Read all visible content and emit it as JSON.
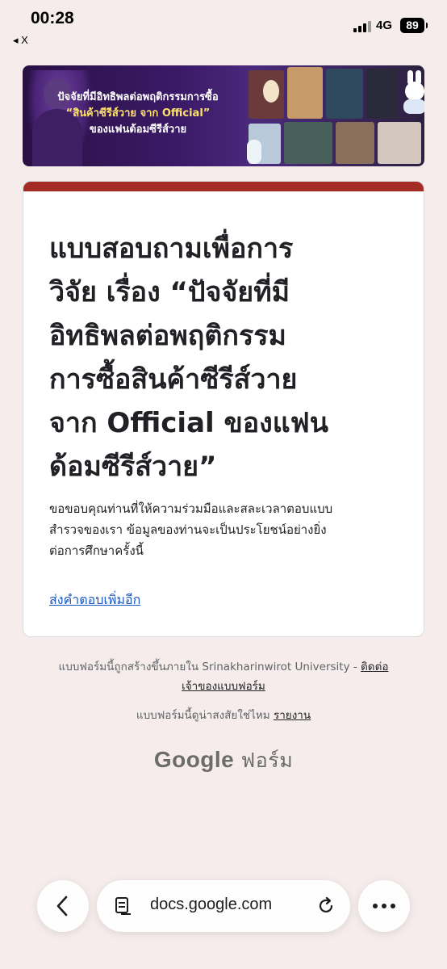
{
  "status_bar": {
    "time": "00:28",
    "back_app": "◂ X",
    "network": "4G",
    "battery": "89"
  },
  "banner": {
    "line1": "ปัจจัยที่มีอิทธิพลต่อพฤติกรรมการซื้อ",
    "line2": "“สินค้าซีรีส์วาย จาก Official”",
    "line3": "ของแฟนด้อมซีรีส์วาย"
  },
  "form": {
    "accent_color": "#a52b26",
    "title_lines": [
      "แบบสอบถามเพื่อการ",
      "วิจัย เรื่อง “ปัจจัยที่มี",
      "อิทธิพลต่อพฤติกรรม",
      "การซื้อสินค้าซีรีส์วาย",
      "จาก Official ของแฟน",
      "ด้อมซีรีส์วาย”"
    ],
    "description_lines": [
      "ขอขอบคุณท่านที่ให้ความร่วมมือและสละเวลาตอบแบบ",
      "สำรวจของเรา ข้อมูลของท่านจะเป็นประโยชน์อย่างยิ่ง",
      "ต่อการศึกษาครั้งนี้"
    ],
    "link_label": "ส่งคำตอบเพิ่มอีก",
    "link_color": "#1a57c5"
  },
  "footer": {
    "created_text": "แบบฟอร์มนี้ถูกสร้างขึ้นภายใน Srinakharinwirot University - ",
    "contact_link_line1": "ติดต่อ",
    "contact_link_line2": "เจ้าของแบบฟอร์ม",
    "suspicious_text": "แบบฟอร์มนี้ดูน่าสงสัยใช่ไหม ",
    "report_link": "รายงาน",
    "brand_google": "Google",
    "brand_forms": "ฟอร์ม"
  },
  "browser": {
    "url": "docs.google.com",
    "icons": [
      "chevron-left-icon",
      "page-icon",
      "reload-icon",
      "more-icon"
    ]
  }
}
